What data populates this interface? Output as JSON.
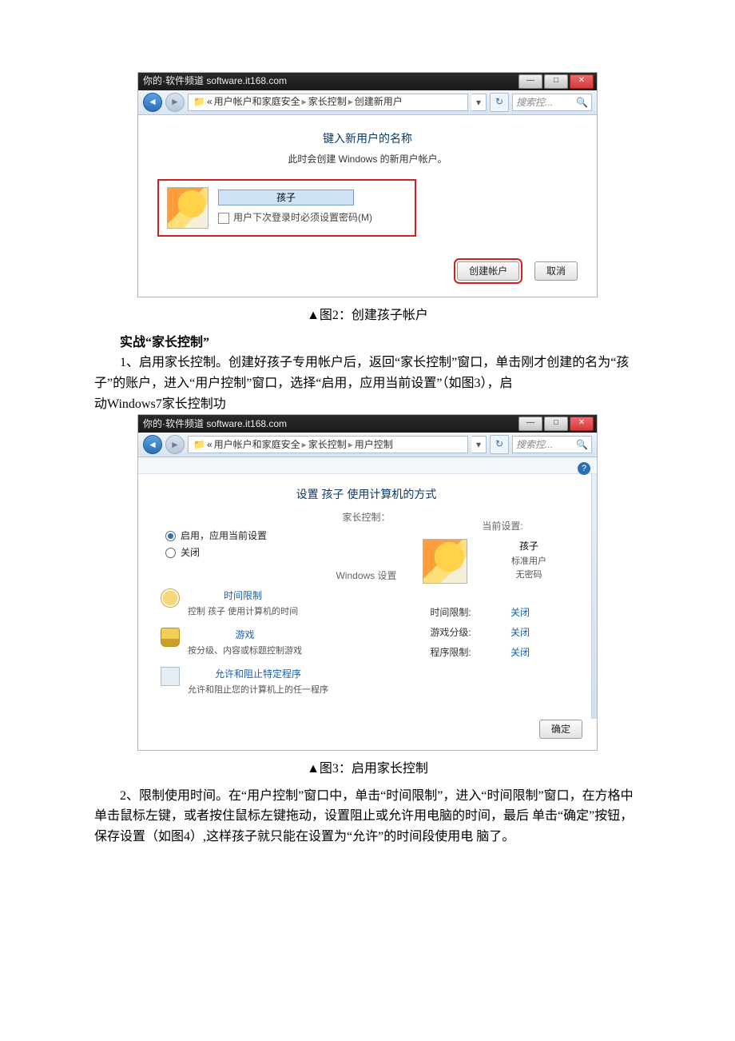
{
  "fig2": {
    "title_watermark": "你的·软件频道 software.it168.com",
    "breadcrumb_prefix": "«",
    "breadcrumb_parts": [
      "用户帐户和家庭安全",
      "家长控制",
      "创建新用户"
    ],
    "search_placeholder": "搜索控...",
    "heading": "键入新用户的名称",
    "subheading": "此时会创建 Windows 的新用户帐户。",
    "username_value": "孩子",
    "checkbox_label": "用户下次登录时必须设置密码(M)",
    "btn_create": "创建帐户",
    "btn_cancel": "取消"
  },
  "caption2": "▲图2：创建孩子帐户",
  "section_title": "实战“家长控制”",
  "para1a": "1、启用家长控制。创建好孩子专用帐户后，返回“家长控制”窗口，单击刚才创建的名为“孩子”的账户，进入“用户控制”窗口，选择“启用，应用当前设置”（如图3），启",
  "para1b": "动Windows7家长控制功",
  "fig3": {
    "title_watermark": "你的·软件频道 software.it168.com",
    "breadcrumb_prefix": "«",
    "breadcrumb_parts": [
      "用户帐户和家庭安全",
      "家长控制",
      "用户控制"
    ],
    "search_placeholder": "搜索控...",
    "heading": "设置 孩子 使用计算机的方式",
    "group_label": "家长控制：",
    "radio_on": "启用，应用当前设置",
    "radio_off": "关闭",
    "win_settings_label": "Windows 设置",
    "items": [
      {
        "title": "时间限制",
        "desc": "控制 孩子 使用计算机的时间"
      },
      {
        "title": "游戏",
        "desc": "按分级、内容或标题控制游戏"
      },
      {
        "title": "允许和阻止特定程序",
        "desc": "允许和阻止您的计算机上的任一程序"
      }
    ],
    "current_label": "当前设置:",
    "user_name": "孩子",
    "user_type": "标准用户",
    "user_pass": "无密码",
    "rows": [
      {
        "k": "时间限制:",
        "v": "关闭"
      },
      {
        "k": "游戏分级:",
        "v": "关闭"
      },
      {
        "k": "程序限制:",
        "v": "关闭"
      }
    ],
    "btn_ok": "确定"
  },
  "caption3": "▲图3：启用家长控制",
  "para2": "2、限制使用时间。在“用户控制”窗口中，单击“时间限制”，进入“时间限制”窗口，在方格中单击鼠标左键，或者按住鼠标左键拖动，设置阻止或允许用电脑的时间，最后 单击“确定”按钮，保存设置（如图4）,这样孩子就只能在设置为“允许”的时间段使用电 脑了。"
}
